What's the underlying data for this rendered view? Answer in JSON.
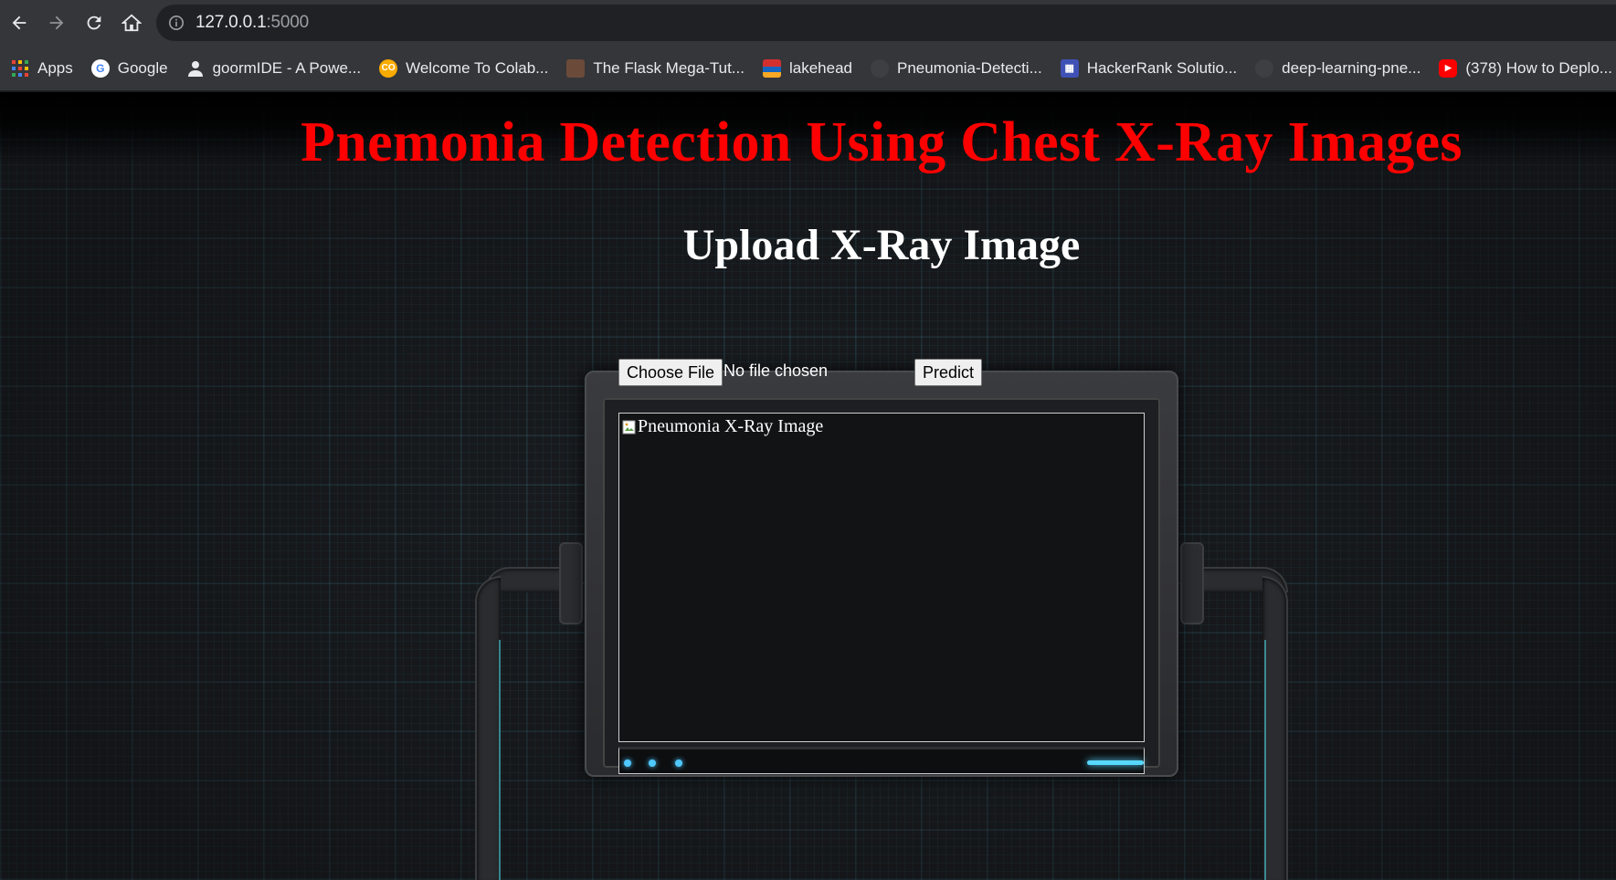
{
  "browser": {
    "url_host": "127.0.0.1",
    "url_port": ":5000"
  },
  "bookmarks": [
    {
      "label": "Apps",
      "icon": "apps-grid-icon"
    },
    {
      "label": "Google",
      "icon": "google-icon"
    },
    {
      "label": "goormIDE - A Powe...",
      "icon": "person-icon"
    },
    {
      "label": "Welcome To Colab...",
      "icon": "colab-icon"
    },
    {
      "label": "The Flask Mega-Tut...",
      "icon": "flask-tutorial-icon"
    },
    {
      "label": "lakehead",
      "icon": "lakehead-icon"
    },
    {
      "label": "Pneumonia-Detecti...",
      "icon": "github-icon"
    },
    {
      "label": "HackerRank Solutio...",
      "icon": "hackerrank-icon"
    },
    {
      "label": "deep-learning-pne...",
      "icon": "github-icon"
    },
    {
      "label": "(378) How to Deplo...",
      "icon": "youtube-icon"
    }
  ],
  "page": {
    "title": "Pnemonia Detection Using Chest X-Ray Images",
    "subtitle": "Upload X-Ray Image",
    "choose_file_label": "Choose File",
    "file_status": "No file chosen",
    "predict_label": "Predict",
    "image_alt": "Pneumonia X-Ray Image"
  },
  "colors": {
    "title": "#ff0000",
    "accent_glow": "#56d8ff"
  }
}
